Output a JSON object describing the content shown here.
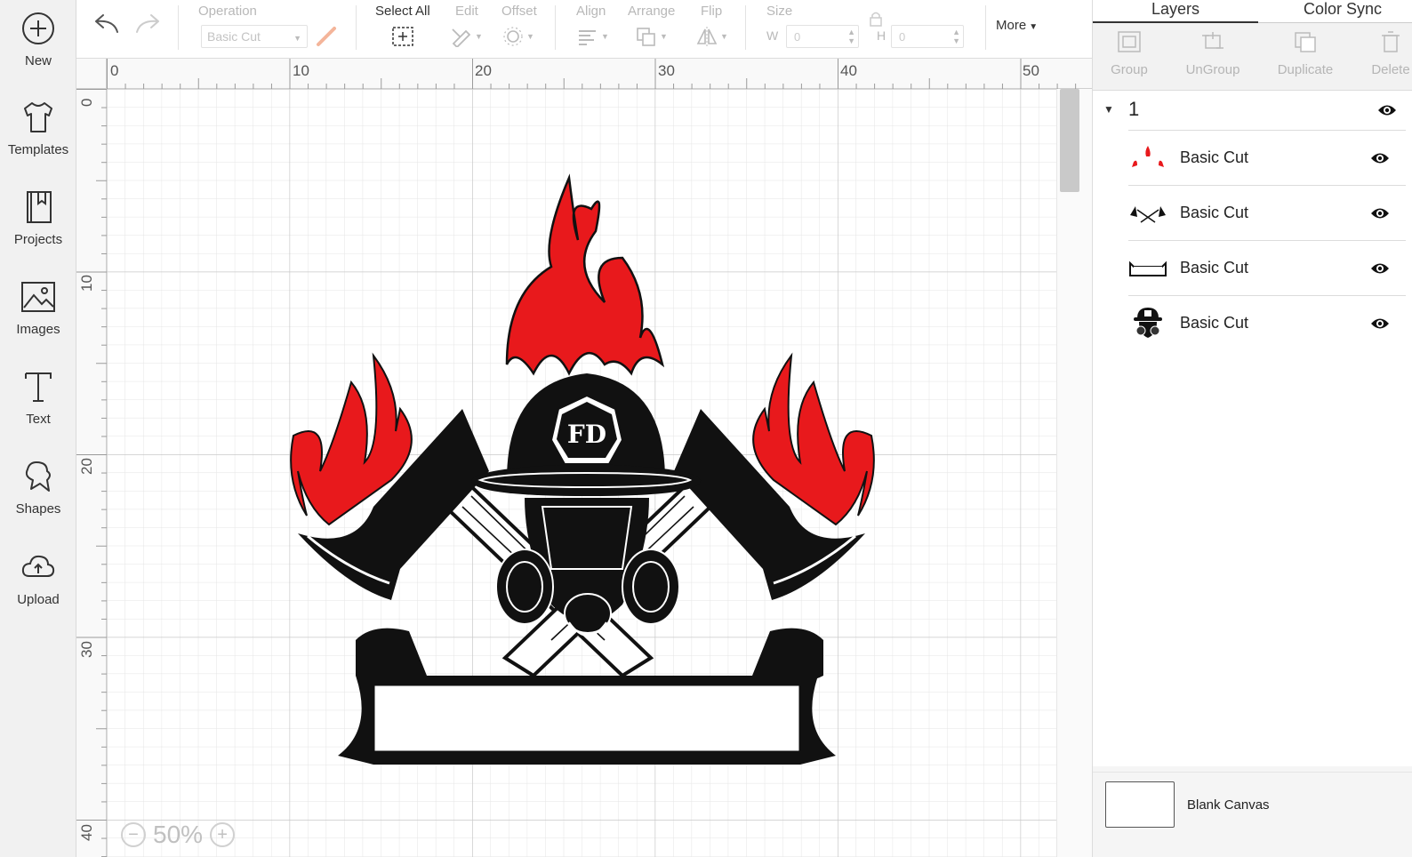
{
  "sidebar": {
    "items": [
      {
        "label": "New",
        "icon": "plus-circle-icon"
      },
      {
        "label": "Templates",
        "icon": "tshirt-icon"
      },
      {
        "label": "Projects",
        "icon": "bookmark-book-icon"
      },
      {
        "label": "Images",
        "icon": "image-icon"
      },
      {
        "label": "Text",
        "icon": "text-t-icon"
      },
      {
        "label": "Shapes",
        "icon": "shapes-icon"
      },
      {
        "label": "Upload",
        "icon": "cloud-upload-icon"
      }
    ]
  },
  "toolbar": {
    "operation_label": "Operation",
    "operation_value": "Basic Cut",
    "select_all_label": "Select All",
    "edit_label": "Edit",
    "offset_label": "Offset",
    "align_label": "Align",
    "arrange_label": "Arrange",
    "flip_label": "Flip",
    "size_label": "Size",
    "w_label": "W",
    "h_label": "H",
    "w_value": "0",
    "h_value": "0",
    "more_label": "More"
  },
  "canvas": {
    "ruler_top": [
      "0",
      "10",
      "20",
      "30",
      "40",
      "50"
    ],
    "ruler_left": [
      "0",
      "10",
      "20",
      "30",
      "40"
    ],
    "zoom_value": "50%",
    "design": {
      "title": "Firefighter helmet emblem",
      "badge_text": "FD",
      "colors": {
        "flame": "#e8191c",
        "ink": "#111111"
      }
    }
  },
  "panel": {
    "tabs": [
      "Layers",
      "Color Sync"
    ],
    "actions": [
      "Group",
      "UnGroup",
      "Duplicate",
      "Delete"
    ],
    "group_name": "1",
    "layers": [
      {
        "name": "Basic Cut",
        "thumb": "flames-thumb"
      },
      {
        "name": "Basic Cut",
        "thumb": "axes-thumb"
      },
      {
        "name": "Basic Cut",
        "thumb": "banner-thumb"
      },
      {
        "name": "Basic Cut",
        "thumb": "helmet-thumb"
      }
    ],
    "canvas_label": "Blank Canvas"
  }
}
